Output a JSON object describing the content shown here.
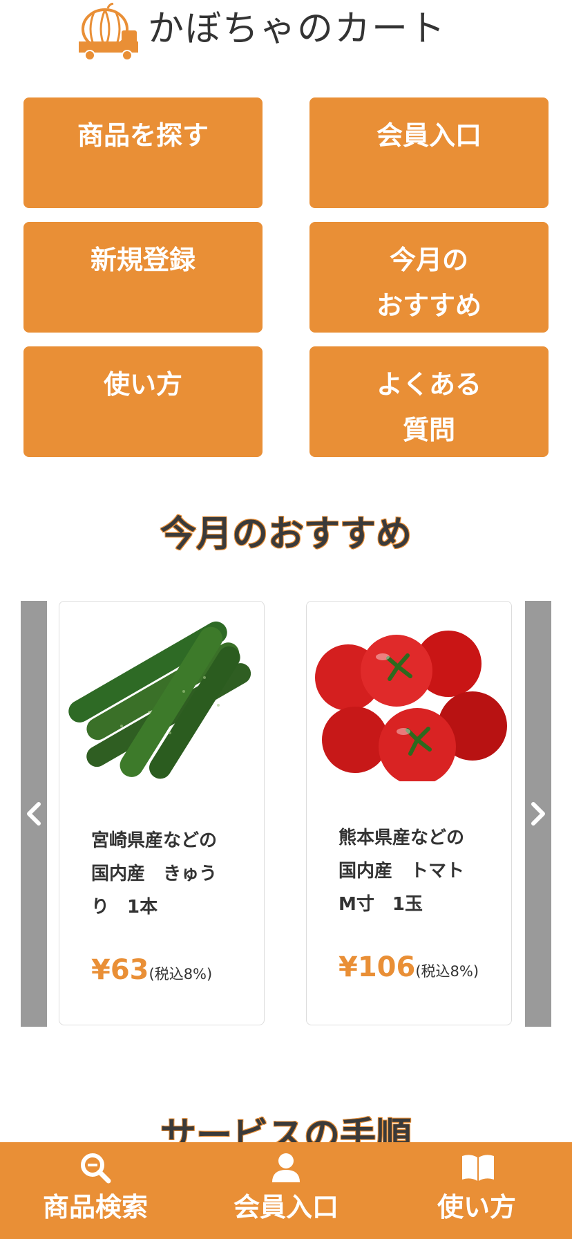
{
  "header": {
    "logo_text": "かぼちゃのカート",
    "logo_icon": "pumpkin-truck-icon"
  },
  "menu": [
    {
      "label": "商品を探す"
    },
    {
      "label": "会員入口"
    },
    {
      "label": "新規登録"
    },
    {
      "label": "今月の\nおすすめ"
    },
    {
      "label": "使い方"
    },
    {
      "label": "よくある\n質問"
    }
  ],
  "recommend": {
    "title": "今月のおすすめ",
    "prev_icon": "chevron-left-icon",
    "next_icon": "chevron-right-icon",
    "products": [
      {
        "name": "宮崎県産などの国内産　きゅうり　1本",
        "price": "¥63",
        "tax": "(税込8%)",
        "image": "cucumber-image"
      },
      {
        "name": "熊本県産などの国内産　トマトM寸　1玉",
        "price": "¥106",
        "tax": "(税込8%)",
        "image": "tomato-image"
      }
    ]
  },
  "service": {
    "title": "サービスの手順"
  },
  "bottom_nav": [
    {
      "label": "商品検索",
      "icon": "search-icon"
    },
    {
      "label": "会員入口",
      "icon": "user-icon"
    },
    {
      "label": "使い方",
      "icon": "book-icon"
    }
  ],
  "colors": {
    "accent": "#e98f36",
    "arrow_bg": "#9a9a9a"
  }
}
